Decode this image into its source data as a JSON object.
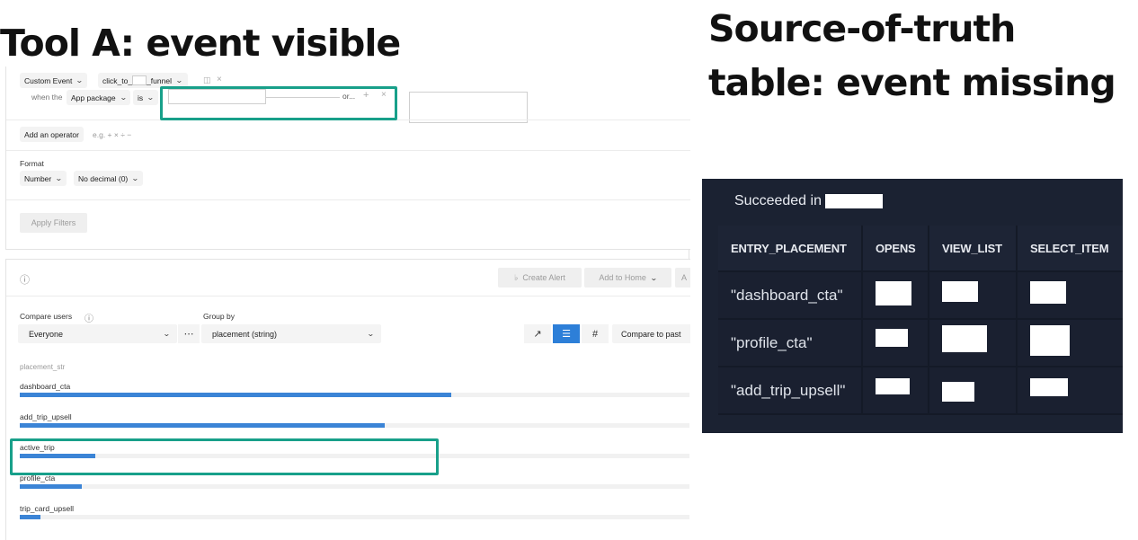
{
  "titles": {
    "tool_a": "Tool A: event visible",
    "sot_line1": "Source-of-truth",
    "sot_line2": "table: event missing"
  },
  "filters": {
    "event_type": "Custom Event",
    "event_name_prefix": "click_to_",
    "event_name_suffix": "_funnel",
    "when_the": "when the",
    "property": "App package",
    "operator": "is",
    "or_label": "or...",
    "add_operator": "Add an operator",
    "add_operator_hint": "e.g. + × ÷ −",
    "format_label": "Format",
    "format_type": "Number",
    "decimal": "No decimal (0)",
    "apply": "Apply Filters"
  },
  "toolbar": {
    "create_alert": "Create Alert",
    "add_to_home": "Add to Home",
    "more_initial": "A"
  },
  "controls": {
    "compare_users_label": "Compare users",
    "compare_users_value": "Everyone",
    "group_by_label": "Group by",
    "group_by_value": "placement (string)",
    "compare_to_past": "Compare to past"
  },
  "chart_data": {
    "type": "bar",
    "orientation": "horizontal",
    "axis_label": "placement_str",
    "categories": [
      "dashboard_cta",
      "add_trip_upsell",
      "active_trip",
      "profile_cta",
      "trip_card_upsell"
    ],
    "values": [
      100,
      84.5,
      17.6,
      14.4,
      4.8
    ],
    "value_units": "relative (no values shown)",
    "bar_color": "#3b84d6",
    "highlighted_category": "active_trip",
    "highlight_color": "#18a08a"
  },
  "sot": {
    "header": "Succeeded in",
    "columns": [
      "ENTRY_PLACEMENT",
      "OPENS",
      "VIEW_LIST",
      "SELECT_ITEM"
    ],
    "rows": [
      {
        "placement": "\"dashboard_cta\""
      },
      {
        "placement": "\"profile_cta\""
      },
      {
        "placement": "\"add_trip_upsell\""
      }
    ],
    "bg_color": "#1b2232"
  }
}
